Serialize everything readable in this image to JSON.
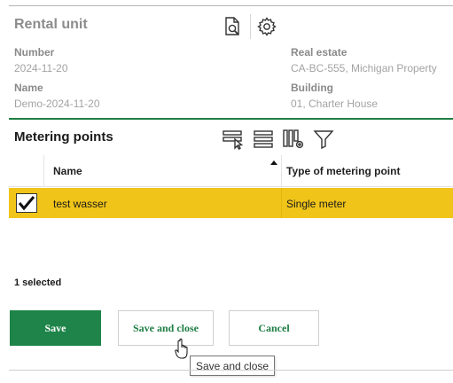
{
  "header": {
    "title": "Rental unit",
    "icons": [
      "document-search-icon",
      "gear-icon"
    ]
  },
  "fields": {
    "number_label": "Number",
    "number_value": "2024-11-20",
    "name_label": "Name",
    "name_value": "Demo-2024-11-20",
    "real_estate_label": "Real estate",
    "real_estate_value": "CA-BC-555, Michigan Property",
    "building_label": "Building",
    "building_value": "01, Charter House"
  },
  "metering": {
    "title": "Metering points",
    "toolbar_icons": [
      "select-rows-icon",
      "list-view-icon",
      "column-settings-icon",
      "filter-icon"
    ],
    "columns": [
      "Name",
      "Type of metering point"
    ],
    "sort_column": "Name",
    "sort_direction": "ascending",
    "rows": [
      {
        "name": "test wasser",
        "type": "Single meter",
        "selected": true
      }
    ],
    "selected_label": "1 selected"
  },
  "actions": {
    "save": "Save",
    "save_close": "Save and close",
    "cancel": "Cancel"
  },
  "tooltip": "Save and close",
  "colors": {
    "accent_green": "#1e8449",
    "selected_row": "#f0c419",
    "muted_text": "#a3a3a3"
  }
}
